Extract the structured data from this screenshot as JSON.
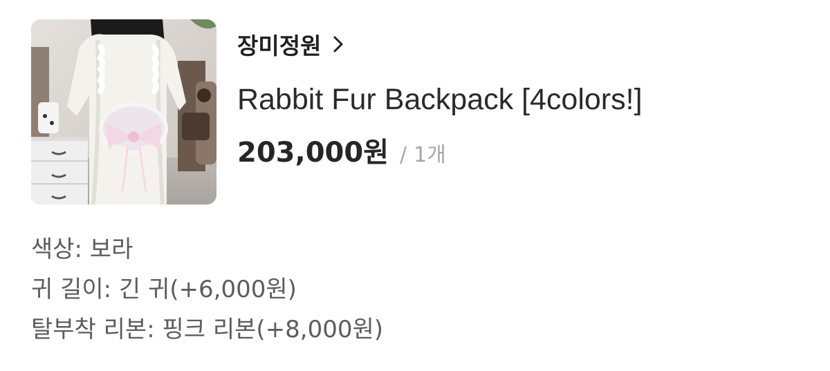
{
  "product": {
    "image_alt": "product-photo",
    "store_name": "장미정원",
    "name": "Rabbit Fur Backpack [4colors!]",
    "price": "203,000원",
    "qty_separator": "/",
    "quantity": "1개"
  },
  "options": [
    {
      "text": "색상: 보라"
    },
    {
      "text": "귀 길이: 긴 귀(+6,000원)"
    },
    {
      "text": "탈부착 리본: 핑크 리본(+8,000원)"
    }
  ],
  "icons": {
    "chevron": "chevron-right-icon"
  }
}
